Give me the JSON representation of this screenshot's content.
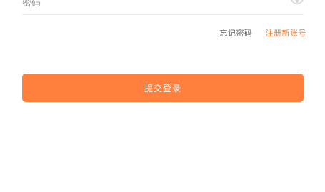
{
  "login_form": {
    "password_placeholder": "密码",
    "password_value": "",
    "visibility_icon": "eye-icon",
    "forgot_password_label": "忘记密码",
    "register_label": "注册新账号",
    "submit_label": "提交登录"
  },
  "colors": {
    "accent": "#ff7f3c",
    "register_link": "#ff7d2f",
    "muted_text": "#666666",
    "divider": "#ececec"
  }
}
